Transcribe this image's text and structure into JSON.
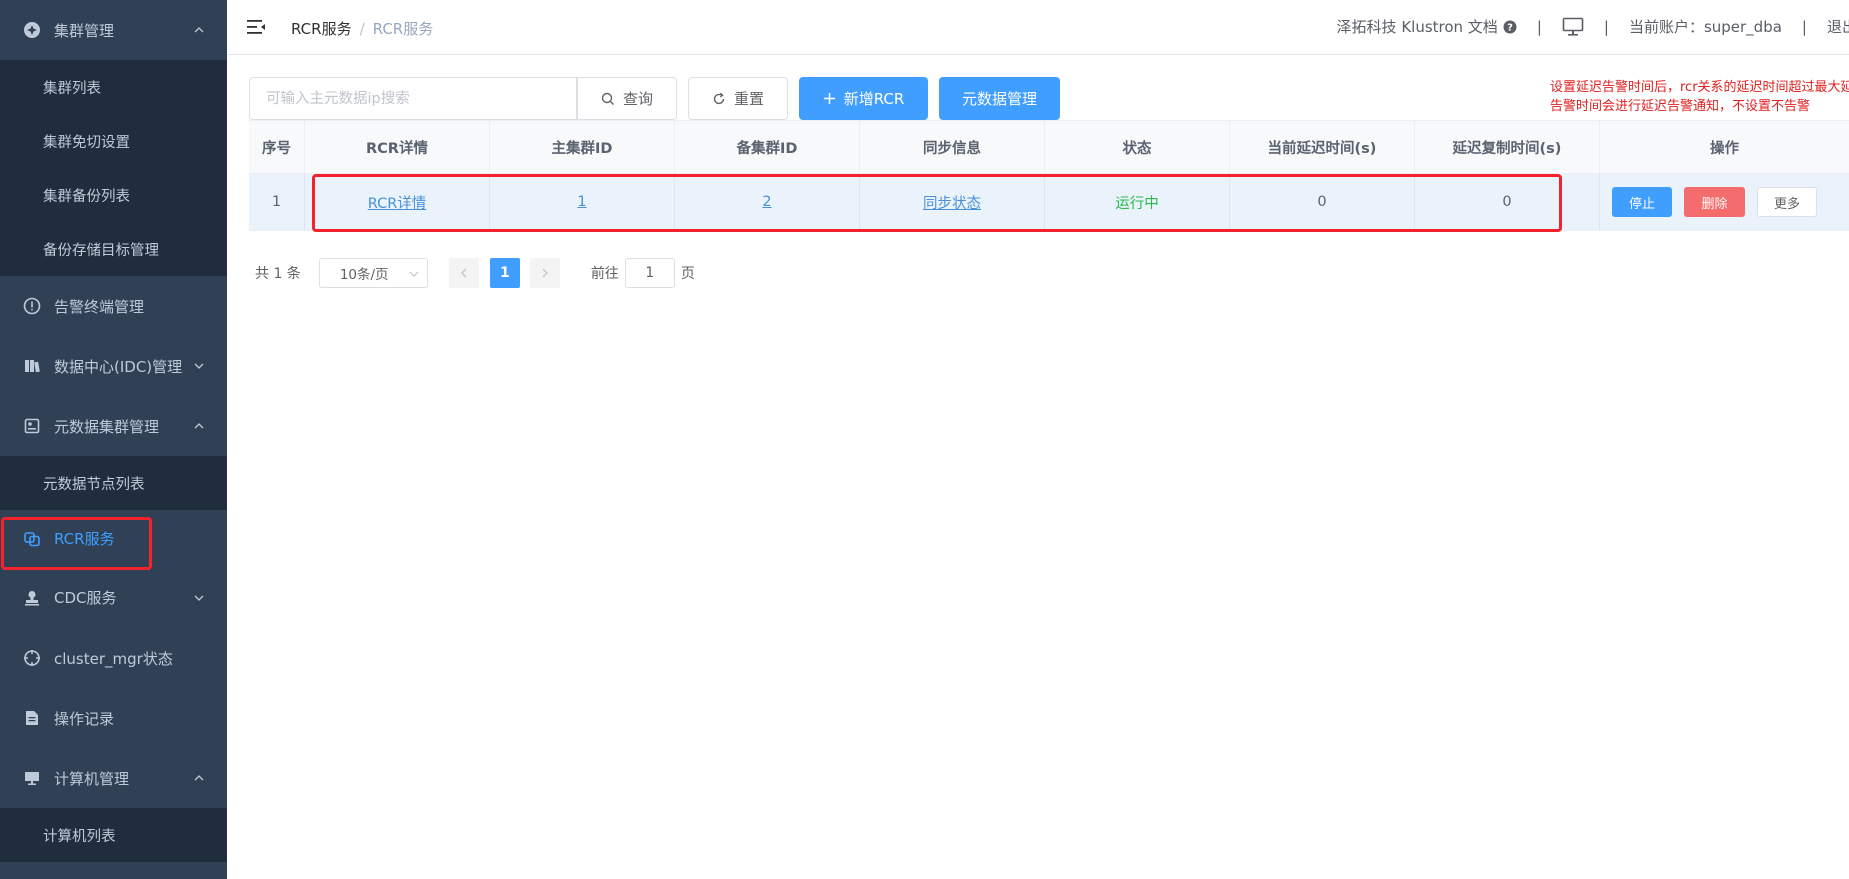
{
  "sidebar": {
    "groups": [
      {
        "label": "集群管理",
        "icon": "gear-icon",
        "expanded": true,
        "items": [
          "集群列表",
          "集群免切设置",
          "集群备份列表",
          "备份存储目标管理"
        ]
      },
      {
        "label": "告警终端管理",
        "icon": "alert-circle-icon"
      },
      {
        "label": "数据中心(IDC)管理",
        "icon": "building-icon",
        "expanded": false
      },
      {
        "label": "元数据集群管理",
        "icon": "meta-cluster-icon",
        "expanded": true,
        "items": [
          "元数据节点列表"
        ]
      },
      {
        "label": "RCR服务",
        "icon": "rcr-icon",
        "active": true
      },
      {
        "label": "CDC服务",
        "icon": "stamp-icon",
        "expanded": false
      },
      {
        "label": "cluster_mgr状态",
        "icon": "crosshair-icon"
      },
      {
        "label": "操作记录",
        "icon": "document-icon"
      },
      {
        "label": "计算机管理",
        "icon": "monitor-icon",
        "expanded": true,
        "items": [
          "计算机列表"
        ]
      }
    ]
  },
  "header": {
    "breadcrumb": [
      "RCR服务",
      "RCR服务"
    ],
    "breadcrumb_sep": "/",
    "brand_docs": "泽拓科技 Klustron 文档",
    "separator": "|",
    "account_label": "当前账户：super_dba",
    "logout": "退出"
  },
  "toolbar": {
    "search_placeholder": "可输入主元数据ip搜索",
    "search_value": "",
    "search_button": "查询",
    "reset_button": "重置",
    "add_button": "新增RCR",
    "meta_button": "元数据管理",
    "note_line1": "设置延迟告警时间后，rcr关系的延迟时间超过最大延",
    "note_line2": "告警时间会进行延迟告警通知，不设置不告警"
  },
  "table": {
    "headers": [
      "序号",
      "RCR详情",
      "主集群ID",
      "备集群ID",
      "同步信息",
      "状态",
      "当前延迟时间(s)",
      "延迟复制时间(s)",
      "操作"
    ],
    "rows": [
      {
        "index": "1",
        "detail": "RCR详情",
        "master_id": "1",
        "standby_id": "2",
        "sync": "同步状态",
        "status": "运行中",
        "current_delay": "0",
        "replication_delay": "0"
      }
    ],
    "ops": {
      "stop": "停止",
      "delete": "删除",
      "more": "更多"
    }
  },
  "pagination": {
    "total": "共 1 条",
    "page_size": "10条/页",
    "current_page": "1",
    "goto_label": "前往",
    "goto_value": "1",
    "page_suffix": "页"
  },
  "colors": {
    "sidebar_bg": "#304156",
    "submenu_bg": "#1f2d3d",
    "primary": "#409eff",
    "danger": "#f56c6c",
    "success": "#2ab94a",
    "highlight": "#f5222d"
  }
}
